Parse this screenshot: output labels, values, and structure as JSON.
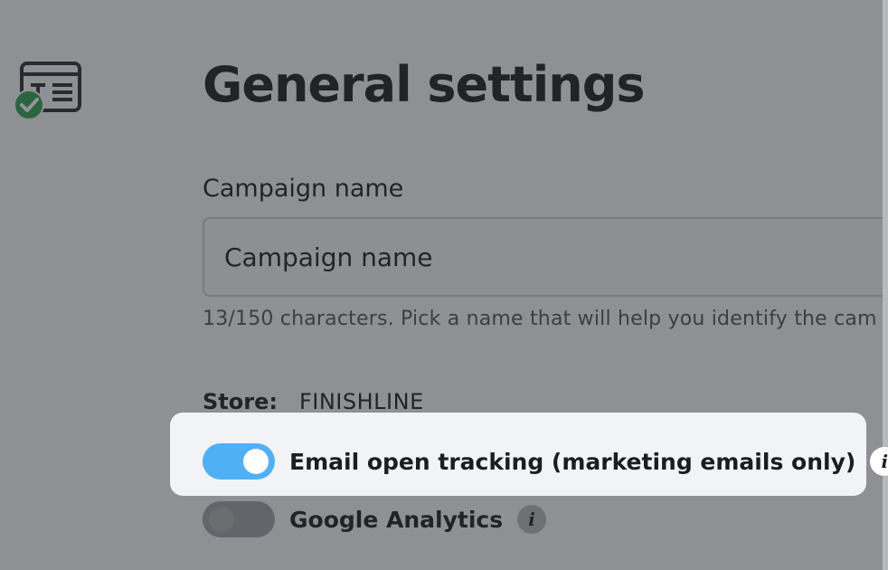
{
  "page": {
    "title": "General settings"
  },
  "campaign": {
    "label": "Campaign name",
    "value": "Campaign name",
    "hint": "13/150 characters. Pick a name that will help you identify the cam"
  },
  "store": {
    "label": "Store:",
    "value": "FINISHLINE"
  },
  "settings": [
    {
      "label": "Email open tracking (marketing emails only)",
      "enabled": true,
      "info": "i"
    },
    {
      "label": "Google Analytics",
      "enabled": false,
      "info": "i"
    }
  ],
  "icons": {
    "step": "template-text-icon",
    "step_status": "check-circle-icon",
    "info": "info-icon"
  },
  "colors": {
    "toggle_on": "#4fb0f6",
    "check_green": "#2f9e54",
    "text": "#1c1d21"
  }
}
